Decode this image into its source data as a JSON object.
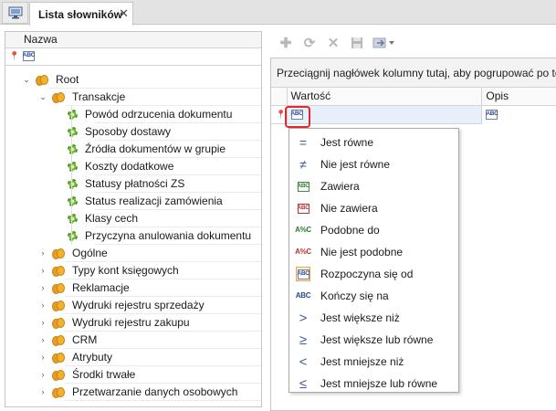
{
  "tab": {
    "title": "Lista słowników",
    "close": "✕"
  },
  "tree": {
    "column_header": "Nazwa",
    "root": "Root",
    "transakcje": "Transakcje",
    "children": [
      "Powód odrzucenia dokumentu",
      "Sposoby dostawy",
      "Źródła dokumentów w grupie",
      "Koszty dodatkowe",
      "Statusy płatności ZS",
      "Status realizacji zamówienia",
      "Klasy cech",
      "Przyczyna anulowania dokumentu"
    ],
    "groups": [
      "Ogólne",
      "Typy kont księgowych",
      "Reklamacje",
      "Wydruki rejestru sprzedaży",
      "Wydruki rejestru zakupu",
      "CRM",
      "Atrybuty",
      "Środki trwałe",
      "Przetwarzanie danych osobowych"
    ]
  },
  "grid": {
    "group_hint": "Przeciągnij nagłówek kolumny tutaj, aby pogrupować po te",
    "col_value": "Wartość",
    "col_desc": "Opis"
  },
  "filter_menu": {
    "items": [
      {
        "label": "Jest równe",
        "icon": "equals-icon"
      },
      {
        "label": "Nie jest równe",
        "icon": "not-equal-icon"
      },
      {
        "label": "Zawiera",
        "icon": "contains-icon"
      },
      {
        "label": "Nie zawiera",
        "icon": "not-contains-icon"
      },
      {
        "label": "Podobne do",
        "icon": "like-icon"
      },
      {
        "label": "Nie jest podobne",
        "icon": "not-like-icon"
      },
      {
        "label": "Rozpoczyna się od",
        "icon": "begins-with-icon"
      },
      {
        "label": "Kończy się na",
        "icon": "ends-with-icon"
      },
      {
        "label": "Jest większe niż",
        "icon": "greater-icon"
      },
      {
        "label": "Jest większe lub równe",
        "icon": "greater-equal-icon"
      },
      {
        "label": "Jest mniejsze niż",
        "icon": "less-icon"
      },
      {
        "label": "Jest mniejsze lub równe",
        "icon": "less-equal-icon"
      }
    ]
  },
  "colors": {
    "highlight": "#e02828",
    "filter_row": "#e6effa",
    "selected_item": "#fff3df"
  }
}
